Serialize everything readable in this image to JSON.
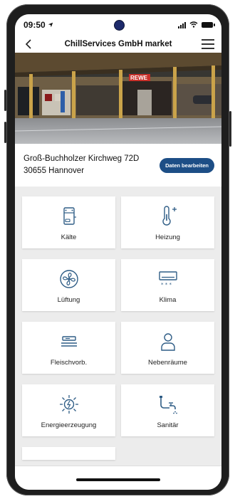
{
  "status": {
    "time": "09:50"
  },
  "nav": {
    "title": "ChillServices GmbH market"
  },
  "hero": {
    "sign_text": "REWE"
  },
  "address": {
    "line1": "Groß-Buchholzer Kirchweg 72D",
    "line2": "30655 Hannover",
    "edit_label": "Daten bearbeiten"
  },
  "tiles": [
    {
      "label": "Kälte",
      "icon": "fridge-icon"
    },
    {
      "label": "Heizung",
      "icon": "thermometer-plus-icon"
    },
    {
      "label": "Lüftung",
      "icon": "fan-icon"
    },
    {
      "label": "Klima",
      "icon": "air-conditioner-icon"
    },
    {
      "label": "Fleischvorb.",
      "icon": "meat-counter-icon"
    },
    {
      "label": "Nebenräume",
      "icon": "person-icon"
    },
    {
      "label": "Energieerzeugung",
      "icon": "sun-energy-icon"
    },
    {
      "label": "Sanitär",
      "icon": "faucet-icon"
    }
  ],
  "colors": {
    "accent": "#1d4e86",
    "icon": "#2f5d86"
  }
}
